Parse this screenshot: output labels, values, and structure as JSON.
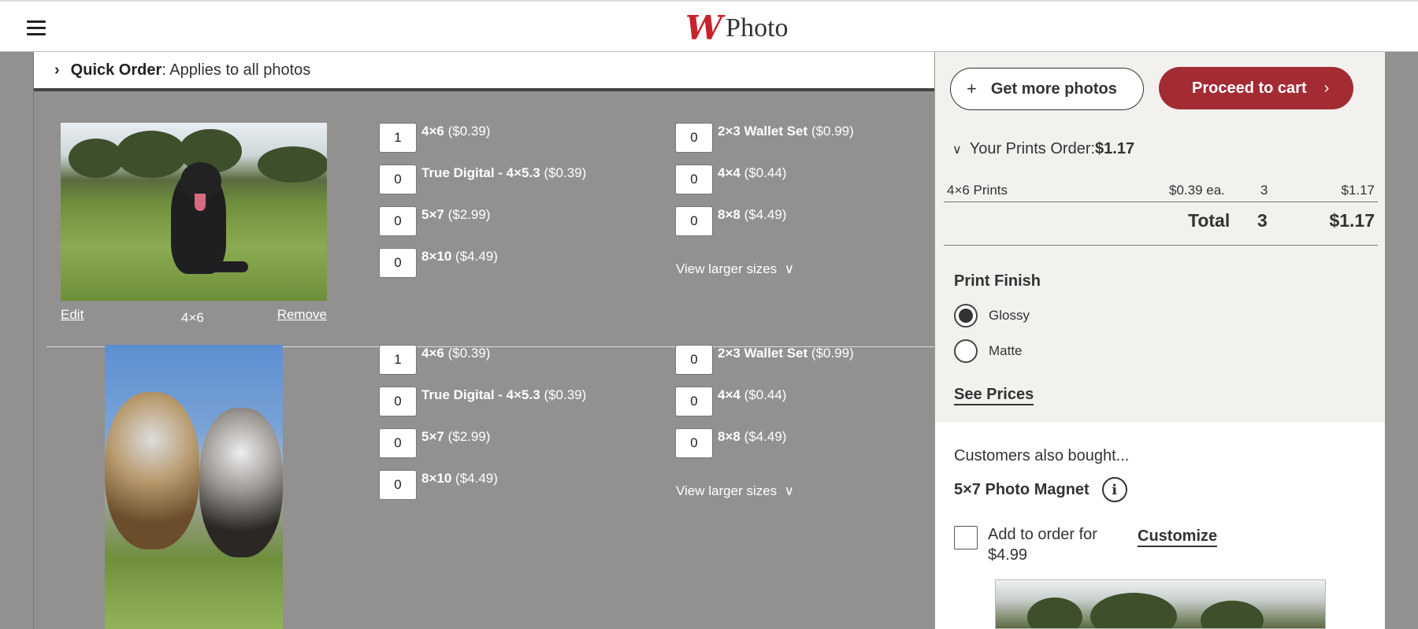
{
  "header": {
    "logo_mark": "W",
    "logo_text": "Photo"
  },
  "quick_order": {
    "bold": "Quick Order",
    "rest": ": Applies to all photos"
  },
  "photos": [
    {
      "size_label": "4×6",
      "edit_label": "Edit",
      "remove_label": "Remove",
      "options_left": [
        {
          "qty": "1",
          "name": "4×6",
          "price": "($0.39)"
        },
        {
          "qty": "0",
          "name": "True Digital - 4×5.3",
          "price": "($0.39)"
        },
        {
          "qty": "0",
          "name": "5×7",
          "price": "($2.99)"
        },
        {
          "qty": "0",
          "name": "8×10",
          "price": "($4.49)"
        }
      ],
      "options_right": [
        {
          "qty": "0",
          "name": "2×3 Wallet Set",
          "price": "($0.99)"
        },
        {
          "qty": "0",
          "name": "4×4",
          "price": "($0.44)"
        },
        {
          "qty": "0",
          "name": "8×8",
          "price": "($4.49)"
        }
      ],
      "view_larger": "View larger sizes"
    },
    {
      "options_left": [
        {
          "qty": "1",
          "name": "4×6",
          "price": "($0.39)"
        },
        {
          "qty": "0",
          "name": "True Digital - 4×5.3",
          "price": "($0.39)"
        },
        {
          "qty": "0",
          "name": "5×7",
          "price": "($2.99)"
        },
        {
          "qty": "0",
          "name": "8×10",
          "price": "($4.49)"
        }
      ],
      "options_right": [
        {
          "qty": "0",
          "name": "2×3 Wallet Set",
          "price": "($0.99)"
        },
        {
          "qty": "0",
          "name": "4×4",
          "price": "($0.44)"
        },
        {
          "qty": "0",
          "name": "8×8",
          "price": "($4.49)"
        }
      ],
      "view_larger": "View larger sizes"
    }
  ],
  "sidebar": {
    "get_more_label": "Get more photos",
    "proceed_label": "Proceed to cart",
    "order_title": "Your Prints Order: ",
    "order_total": "$1.17",
    "item": {
      "name": "4×6 Prints",
      "unit": "$0.39 ea.",
      "qty": "3",
      "amount": "$1.17"
    },
    "total": {
      "label": "Total",
      "qty": "3",
      "amount": "$1.17"
    },
    "finish_title": "Print Finish",
    "finish_options": [
      "Glossy",
      "Matte"
    ],
    "finish_selected": "Glossy",
    "see_prices": "See Prices",
    "also_title": "Customers also bought...",
    "magnet_name": "5×7 Photo Magnet",
    "info_glyph": "i",
    "add_line1": "Add to order for",
    "add_line2": "$4.99",
    "customize": "Customize"
  },
  "icons": [
    "hamburger-icon",
    "chevron-right-icon",
    "chevron-down-icon",
    "plus-icon",
    "arrow-right-icon",
    "info-icon"
  ],
  "colors": {
    "brand_red": "#c8232c",
    "cart_button": "#a32b33",
    "page_bg": "#939090",
    "sidebar_bg": "#f3f1ed"
  }
}
